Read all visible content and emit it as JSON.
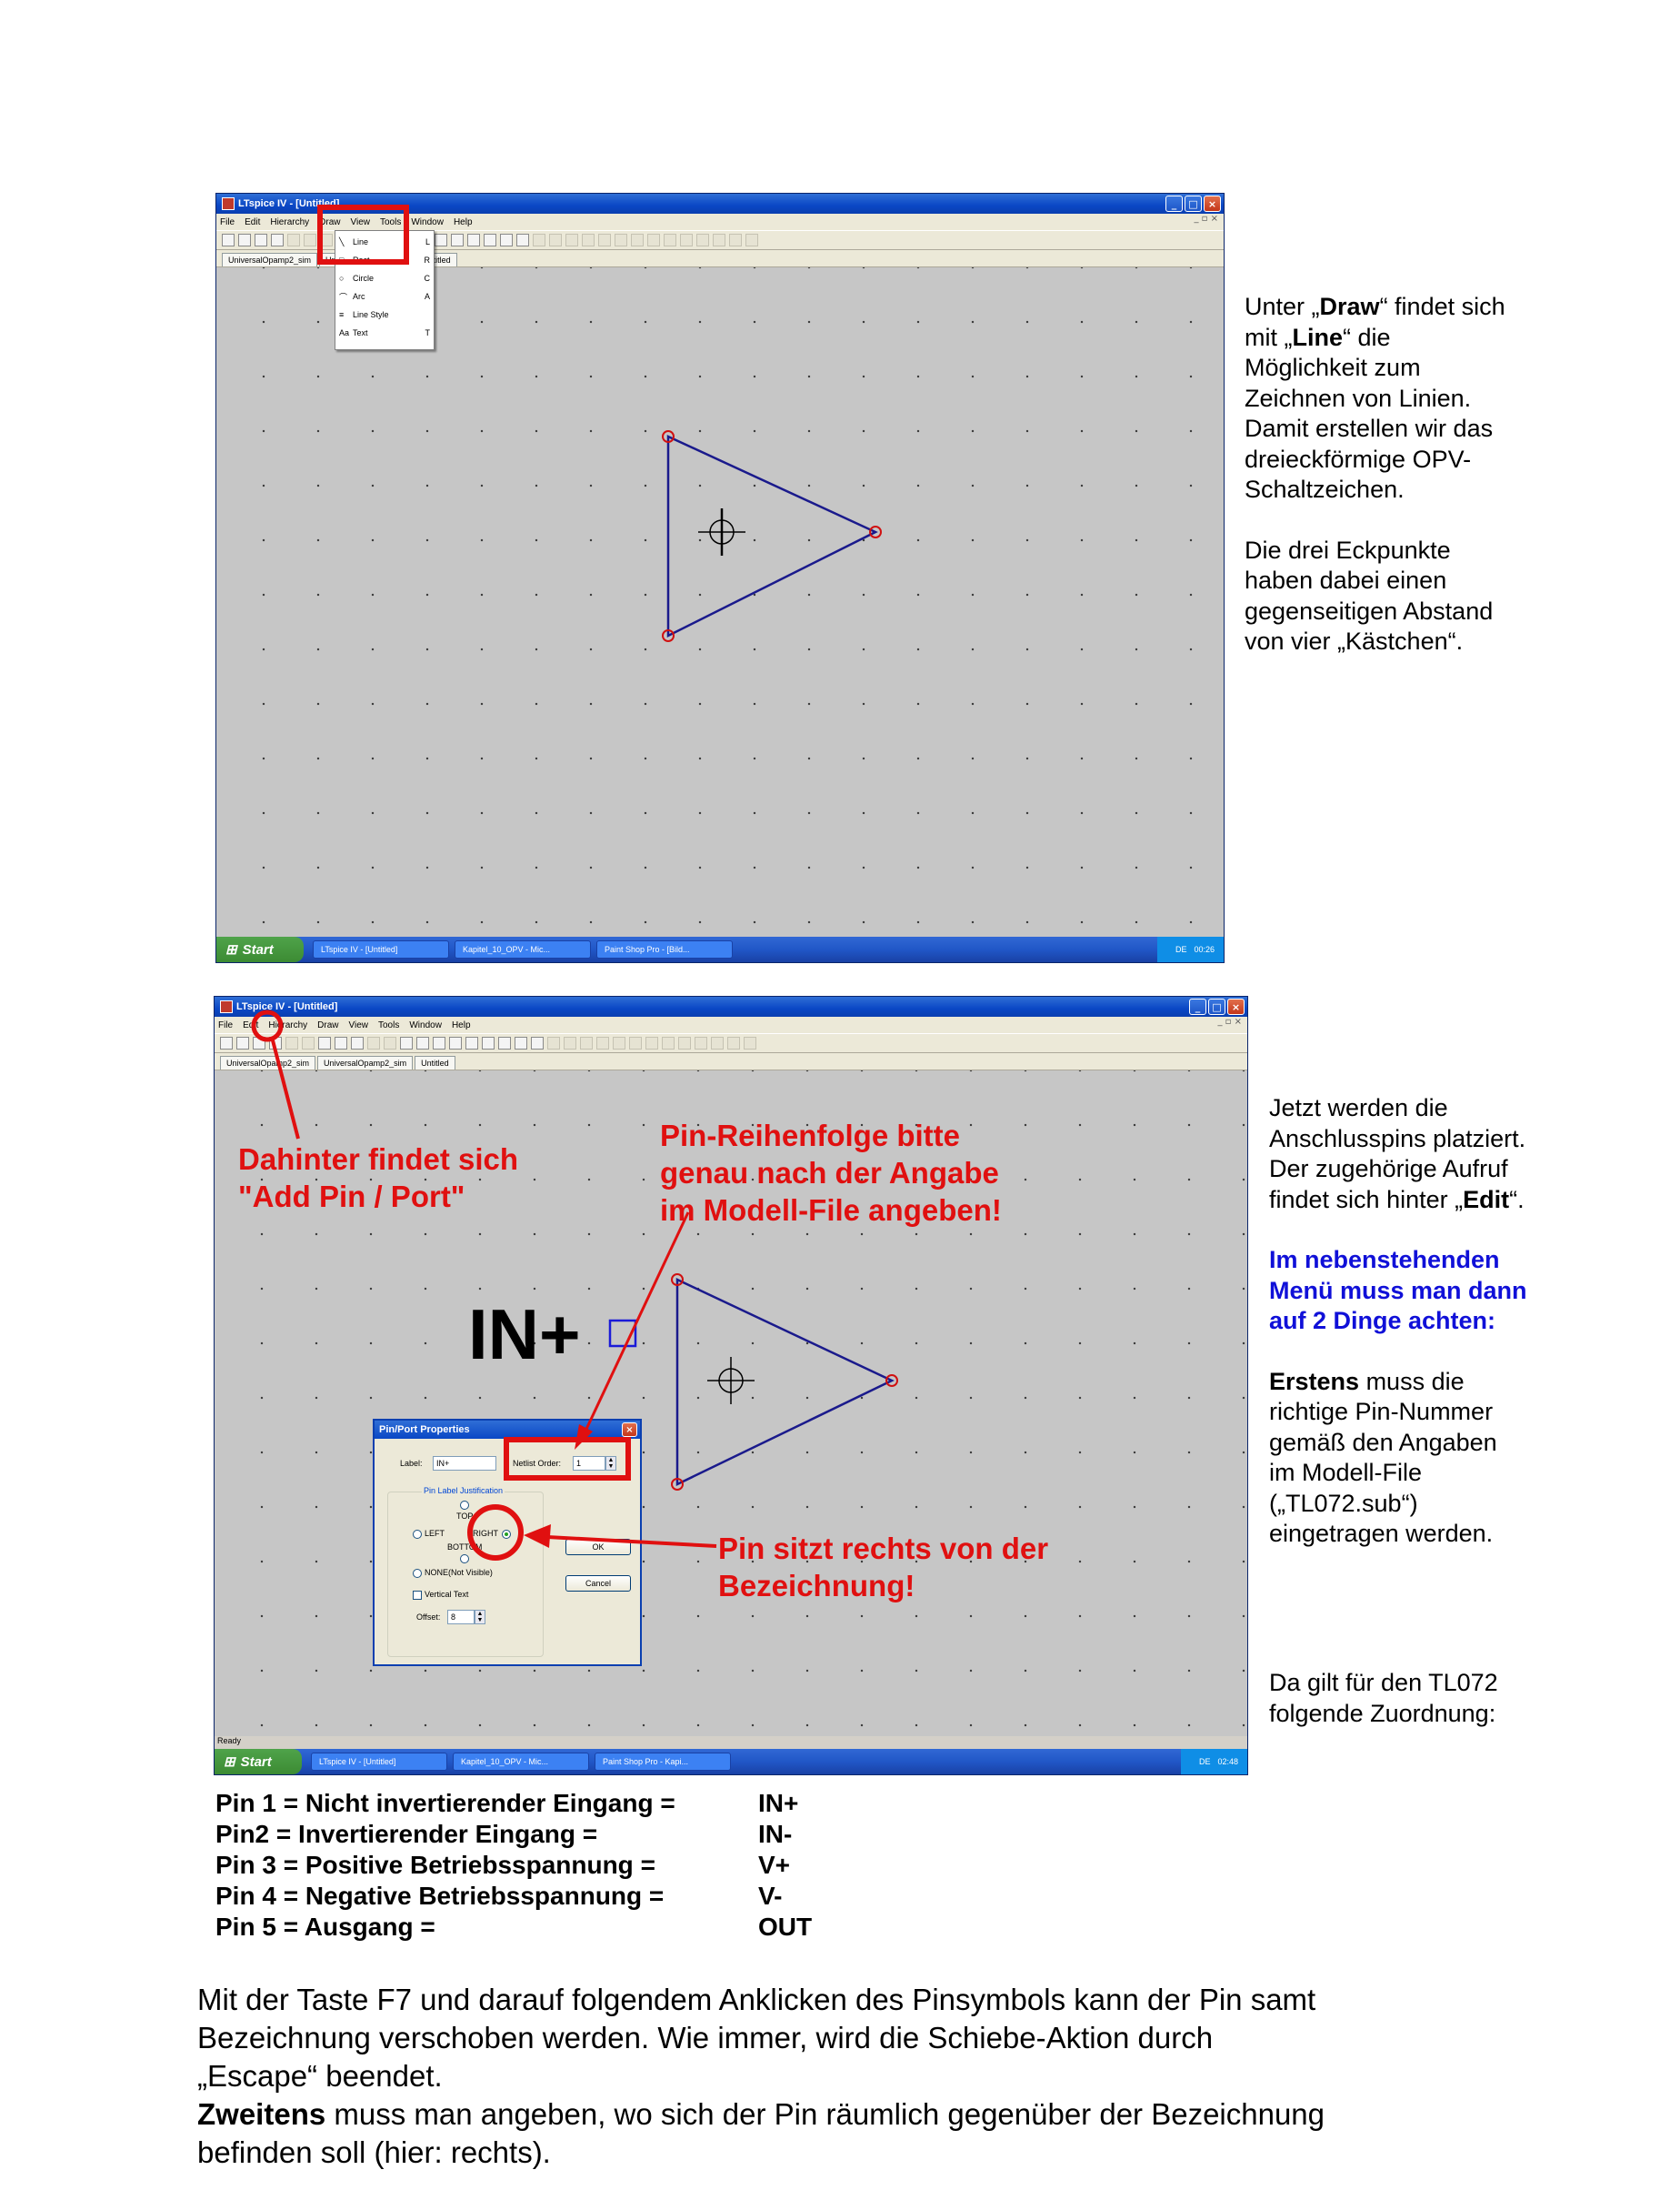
{
  "screenshot1": {
    "title": "LTspice IV - [Untitled]",
    "menus": [
      "File",
      "Edit",
      "Hierarchy",
      "Draw",
      "View",
      "Tools",
      "Window",
      "Help"
    ],
    "tabs": [
      "UniversalOpamp2_sim",
      "UniversalOpamp2_sim",
      "Untitled"
    ],
    "draw_menu": [
      {
        "icon": "line-icon",
        "label": "Line",
        "shortcut": "L"
      },
      {
        "icon": "rect-icon",
        "label": "Rect",
        "shortcut": "R"
      },
      {
        "icon": "circle-icon",
        "label": "Circle",
        "shortcut": "C"
      },
      {
        "icon": "arc-icon",
        "label": "Arc",
        "shortcut": "A"
      },
      {
        "icon": "line-style-icon",
        "label": "Line Style",
        "shortcut": ""
      },
      {
        "icon": "text-icon",
        "label": "Text",
        "shortcut": "T"
      }
    ],
    "taskbar": {
      "start": "Start",
      "tasks": [
        "LTspice IV - [Untitled]",
        "Kapitel_10_OPV - Mic...",
        "Paint Shop Pro - [Bild..."
      ],
      "tray_lang": "DE",
      "clock": "00:26"
    }
  },
  "screenshot2": {
    "title": "LTspice IV - [Untitled]",
    "menus": [
      "File",
      "Edit",
      "Hierarchy",
      "Draw",
      "View",
      "Tools",
      "Window",
      "Help"
    ],
    "tabs": [
      "UniversalOpamp2_sim",
      "UniversalOpamp2_sim",
      "Untitled"
    ],
    "pin_label_big": "IN+",
    "status": "Ready",
    "dialog": {
      "title": "Pin/Port Properties",
      "label_caption": "Label:",
      "label_value": "IN+",
      "netlist_caption": "Netlist Order:",
      "netlist_value": "1",
      "group_title": "Pin Label Justification",
      "top": "TOP",
      "left": "LEFT",
      "right": "RIGHT",
      "bottom": "BOTTOM",
      "none": "NONE(Not Visible)",
      "vertical": "Vertical Text",
      "offset_caption": "Offset:",
      "offset_value": "8",
      "ok": "OK",
      "cancel": "Cancel"
    },
    "annotations": {
      "edit_line1": "Dahinter findet sich",
      "edit_line2": "\"Add Pin / Port\"",
      "order_line1": "Pin-Reihenfolge bitte",
      "order_line2": "genau nach der Angabe",
      "order_line3": "im Modell-File angeben!",
      "right_line1": "Pin sitzt rechts von der",
      "right_line2": "Bezeichnung!"
    },
    "taskbar": {
      "start": "Start",
      "tasks": [
        "LTspice IV - [Untitled]",
        "Kapitel_10_OPV - Mic...",
        "Paint Shop Pro - Kapi..."
      ],
      "tray_lang": "DE",
      "clock": "02:48"
    }
  },
  "side1": {
    "p1_a": "Unter „",
    "p1_draw": "Draw",
    "p1_b": "“ findet sich",
    "p1_c": "mit „",
    "p1_line": "Line",
    "p1_d": "“ die",
    "p1_e": "Möglichkeit zum",
    "p1_f": "Zeichnen von Linien.",
    "p1_g": "Damit erstellen wir das",
    "p1_h": "dreieckförmige OPV-",
    "p1_i": "Schaltzeichen.",
    "p2_a": "Die drei Eckpunkte",
    "p2_b": "haben dabei einen",
    "p2_c": "gegenseitigen Abstand",
    "p2_d": "von vier „Kästchen“."
  },
  "side2": {
    "p1_a": "Jetzt werden die",
    "p1_b": "Anschlusspins platziert.",
    "p1_c": "Der zugehörige Aufruf",
    "p1_d": "findet sich hinter „",
    "p1_edit": "Edit",
    "p1_e": "“.",
    "blue_a": "Im nebenstehenden",
    "blue_b": "Menü muss man dann",
    "blue_c": "auf 2 Dinge achten:",
    "p3_bold": "Erstens",
    "p3_a": " muss die",
    "p3_b": "richtige Pin-Nummer",
    "p3_c": "gemäß den Angaben",
    "p3_d": "im Modell-File",
    "p3_e": "(„TL072.sub“)",
    "p3_f": "eingetragen werden.",
    "p4_a": "Da gilt für den TL072",
    "p4_b": "folgende Zuordnung:"
  },
  "pin_table": [
    {
      "desc": "Pin 1 = Nicht invertierender Eingang =",
      "name": "IN+"
    },
    {
      "desc": "Pin2 = Invertierender Eingang =",
      "name": "IN-"
    },
    {
      "desc": "Pin 3 = Positive Betriebsspannung =",
      "name": "V+"
    },
    {
      "desc": "Pin 4 = Negative Betriebsspannung =",
      "name": "V-"
    },
    {
      "desc": "Pin 5 = Ausgang =",
      "name": "OUT"
    }
  ],
  "bottom": {
    "l1": "Mit der Taste F7 und darauf folgendem Anklicken des Pinsymbols kann der Pin samt",
    "l2": "Bezeichnung verschoben werden. Wie immer, wird die Schiebe-Aktion durch",
    "l3": "„Escape“ beendet.",
    "zw_bold": "Zweitens",
    "l4": " muss man angeben, wo sich der Pin räumlich gegenüber der Bezeichnung",
    "l5": "befinden soll (hier: rechts)."
  },
  "colors": {
    "annotation_red": "#e01010",
    "highlight_blue": "#1010d8",
    "schematic_line": "#1a1a8c",
    "canvas_gray": "#c6c6c6"
  }
}
